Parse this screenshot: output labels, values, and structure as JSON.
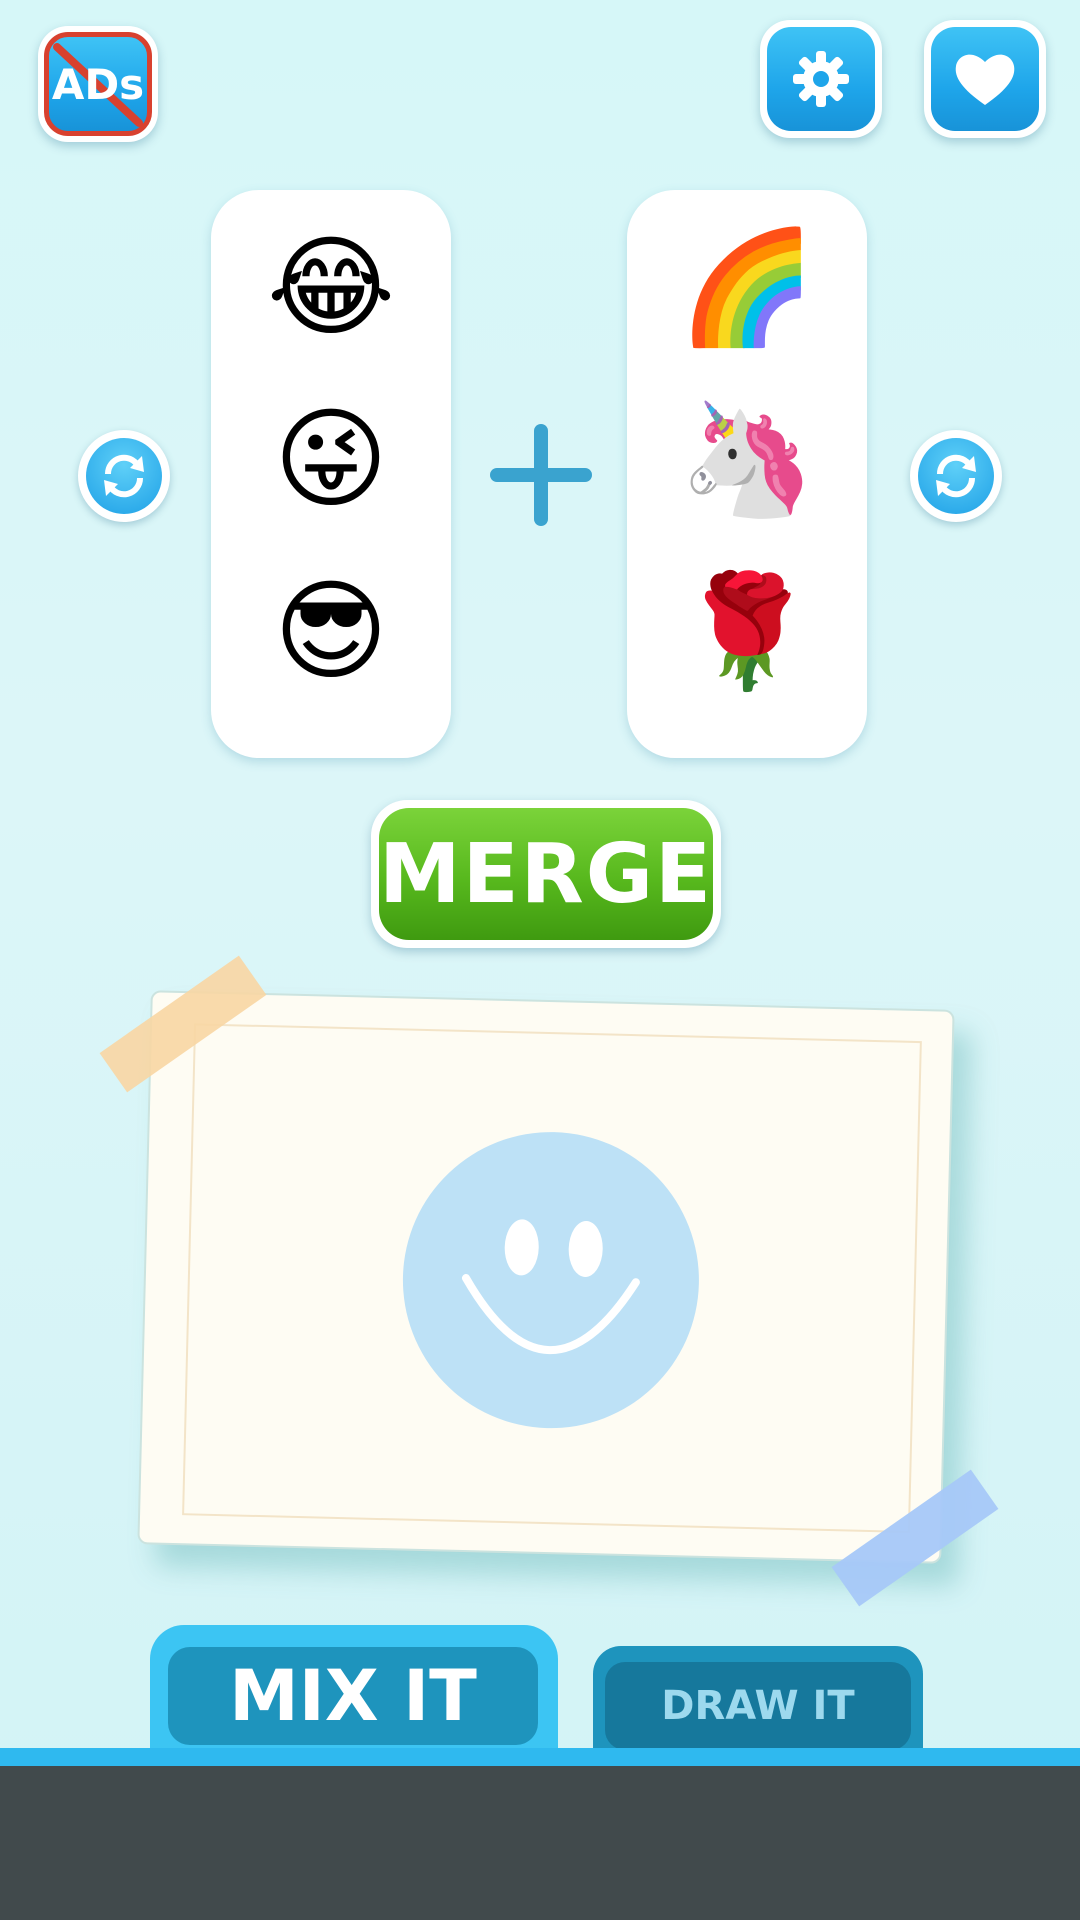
{
  "header": {
    "no_ads_label": "ADs",
    "settings_icon": "gear-icon",
    "favorites_icon": "heart-icon"
  },
  "left_column": {
    "emojis": [
      "😂",
      "😜",
      "😎"
    ]
  },
  "right_column": {
    "emojis": [
      "🌈",
      "🦄",
      "🌹"
    ]
  },
  "plus_symbol": "+",
  "merge": {
    "label": "MERGE"
  },
  "result": {
    "placeholder_icon": "smiley-face-icon"
  },
  "tabs": [
    {
      "label": "MIX IT",
      "active": true
    },
    {
      "label": "DRAW IT",
      "active": false
    }
  ],
  "colors": {
    "accent_blue": "#1ea5ea",
    "merge_green": "#57b81d",
    "ads_red": "#d8412f",
    "placeholder_blue": "#bde1f6"
  }
}
